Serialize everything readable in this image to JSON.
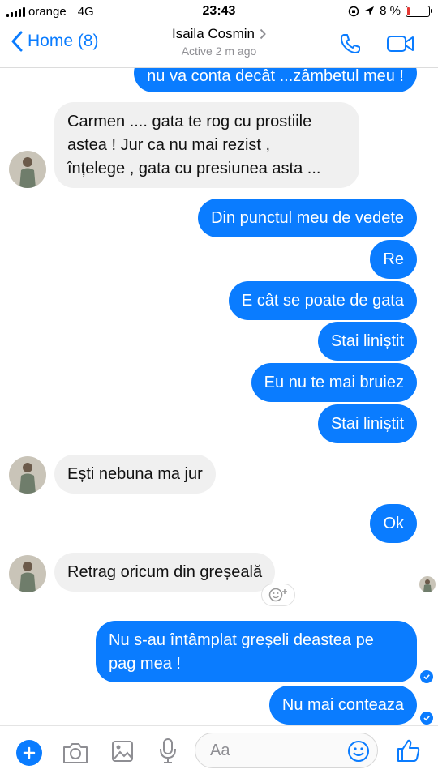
{
  "status_bar": {
    "carrier": "orange",
    "network": "4G",
    "time": "23:43",
    "battery": "8 %",
    "battery_color": "#e53935"
  },
  "header": {
    "back_label": "Home (8)",
    "contact_name": "Isaila Cosmin",
    "contact_status": "Active 2 m ago",
    "icons": [
      "phone-icon",
      "video-camera-icon"
    ]
  },
  "messages": [
    {
      "from": "me",
      "text": "nu va conta decât ...zâmbetul meu !"
    },
    {
      "from": "contact",
      "text": "Carmen .... gata te rog cu prostiile\nastea ! Jur ca nu mai rezist ,\nînțelege , gata cu presiunea asta ..."
    },
    {
      "from": "me",
      "text": "Din punctul meu de vedete"
    },
    {
      "from": "me",
      "text": "Re"
    },
    {
      "from": "me",
      "text": "E cât se poate de gata"
    },
    {
      "from": "me",
      "text": "Stai liniștit"
    },
    {
      "from": "me",
      "text": "Eu nu te mai bruiez"
    },
    {
      "from": "me",
      "text": "Stai liniștit"
    },
    {
      "from": "contact",
      "text": "Ești nebuna ma jur"
    },
    {
      "from": "me",
      "text": "Ok"
    },
    {
      "from": "contact",
      "text": "Retrag oricum din greșeală"
    },
    {
      "from": "me",
      "text": "Nu s-au întâmplat greșeli deastea pe\npag mea !"
    },
    {
      "from": "me",
      "text": "Nu mai conteaza"
    }
  ],
  "composer": {
    "placeholder": "Aa",
    "icons": [
      "plus-icon",
      "camera-icon",
      "image-icon",
      "microphone-icon",
      "emoji-icon",
      "thumbs-up-icon"
    ]
  },
  "colors": {
    "accent": "#0a7cff",
    "incoming_bubble": "#f0f0f0"
  }
}
